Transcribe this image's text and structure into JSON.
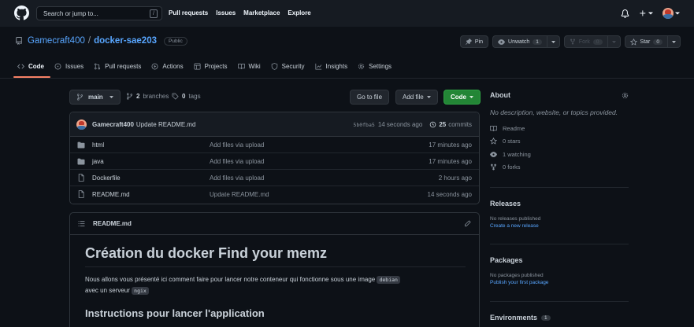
{
  "header": {
    "search_placeholder": "Search or jump to...",
    "slash_key": "/",
    "nav": [
      "Pull requests",
      "Issues",
      "Marketplace",
      "Explore"
    ]
  },
  "repo": {
    "owner": "Gamecraft400",
    "separator": "/",
    "name": "docker-sae203",
    "visibility": "Public",
    "pin_label": "Pin",
    "unwatch_label": "Unwatch",
    "unwatch_count": "1",
    "fork_label": "Fork",
    "fork_count": "0",
    "star_label": "Star",
    "star_count": "0"
  },
  "tabs": [
    {
      "label": "Code",
      "icon": "code-icon"
    },
    {
      "label": "Issues",
      "icon": "issue-icon"
    },
    {
      "label": "Pull requests",
      "icon": "pull-request-icon"
    },
    {
      "label": "Actions",
      "icon": "actions-icon"
    },
    {
      "label": "Projects",
      "icon": "projects-icon"
    },
    {
      "label": "Wiki",
      "icon": "wiki-icon"
    },
    {
      "label": "Security",
      "icon": "shield-icon"
    },
    {
      "label": "Insights",
      "icon": "graph-icon"
    },
    {
      "label": "Settings",
      "icon": "gear-icon"
    }
  ],
  "branch_bar": {
    "branch": "main",
    "branches_count": "2",
    "branches_label": "branches",
    "tags_count": "0",
    "tags_label": "tags",
    "go_to_file": "Go to file",
    "add_file": "Add file",
    "code_button": "Code"
  },
  "commit": {
    "author": "Gamecraft400",
    "message": "Update README.md",
    "sha": "5b0fba5",
    "time": "14 seconds ago",
    "commits_count": "25",
    "commits_label": "commits"
  },
  "files": [
    {
      "name": "html",
      "type": "folder",
      "message": "Add files via upload",
      "time": "17 minutes ago"
    },
    {
      "name": "java",
      "type": "folder",
      "message": "Add files via upload",
      "time": "17 minutes ago"
    },
    {
      "name": "Dockerfile",
      "type": "file",
      "message": "Add files via upload",
      "time": "2 hours ago"
    },
    {
      "name": "README.md",
      "type": "file",
      "message": "Update README.md",
      "time": "14 seconds ago"
    }
  ],
  "readme": {
    "filename": "README.md",
    "h1": "Création du docker Find your memz",
    "p1_text": "Nous allons vous présenté ici comment faire pour lancer notre conteneur qui fonctionne sous une image",
    "p1_code": "debian",
    "p2_text": "avec un serveur",
    "p2_code": "ngix",
    "h2": "Instructions pour lancer l'application"
  },
  "about": {
    "title": "About",
    "description": "No description, website, or topics provided.",
    "items": [
      "Readme",
      "0 stars",
      "1 watching",
      "0 forks"
    ]
  },
  "releases": {
    "title": "Releases",
    "empty": "No releases published",
    "link": "Create a new release"
  },
  "packages": {
    "title": "Packages",
    "empty": "No packages published",
    "link": "Publish your first package"
  },
  "environments": {
    "title": "Environments",
    "count": "1"
  },
  "colors": {
    "bg": "#0d1117",
    "header_bg": "#161b22",
    "link": "#58a6ff",
    "green": "#238636",
    "tab_active": "#f78166"
  }
}
